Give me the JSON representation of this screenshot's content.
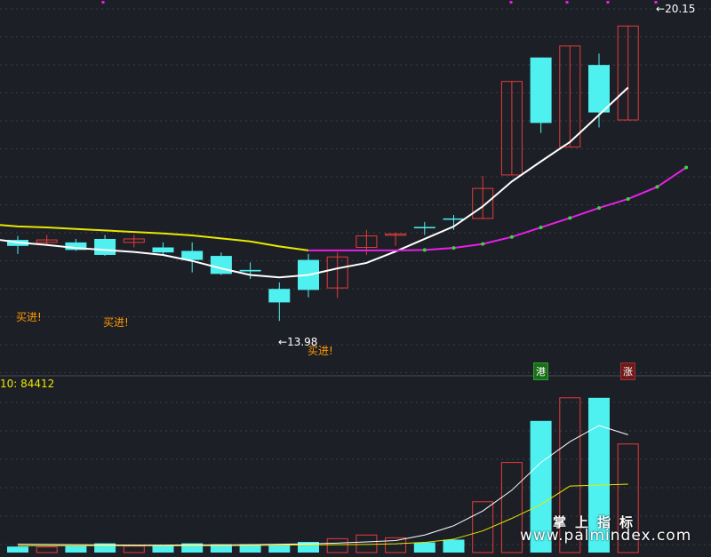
{
  "chart_data": {
    "type": "candlestick",
    "price_axis": {
      "min": 12.9,
      "max": 20.4
    },
    "candles": [
      {
        "open": 15.6,
        "close": 15.48,
        "high": 15.68,
        "low": 15.32
      },
      {
        "open": 15.55,
        "close": 15.6,
        "high": 15.7,
        "low": 15.5
      },
      {
        "open": 15.55,
        "close": 15.4,
        "high": 15.62,
        "low": 15.38
      },
      {
        "open": 15.62,
        "close": 15.3,
        "high": 15.7,
        "low": 15.28
      },
      {
        "open": 15.55,
        "close": 15.62,
        "high": 15.7,
        "low": 15.45
      },
      {
        "open": 15.45,
        "close": 15.35,
        "high": 15.55,
        "low": 15.3
      },
      {
        "open": 15.38,
        "close": 15.2,
        "high": 15.55,
        "low": 14.95
      },
      {
        "open": 15.28,
        "close": 14.92,
        "high": 15.35,
        "low": 14.9
      },
      {
        "open": 15.0,
        "close": 14.97,
        "high": 15.15,
        "low": 14.82
      },
      {
        "open": 14.62,
        "close": 14.35,
        "high": 14.75,
        "low": 13.98
      },
      {
        "open": 15.2,
        "close": 14.6,
        "high": 15.32,
        "low": 14.45
      },
      {
        "open": 14.64,
        "close": 15.26,
        "high": 15.35,
        "low": 14.44
      },
      {
        "open": 15.45,
        "close": 15.68,
        "high": 15.8,
        "low": 15.3
      },
      {
        "open": 15.7,
        "close": 15.72,
        "high": 15.75,
        "low": 15.48
      },
      {
        "open": 15.86,
        "close": 15.84,
        "high": 15.96,
        "low": 15.7
      },
      {
        "open": 16.03,
        "close": 16.01,
        "high": 16.1,
        "low": 15.8
      },
      {
        "open": 16.03,
        "close": 16.63,
        "high": 16.88,
        "low": 16.03
      },
      {
        "open": 16.9,
        "close": 18.77,
        "high": 18.77,
        "low": 16.9
      },
      {
        "open": 19.25,
        "close": 17.94,
        "high": 19.25,
        "low": 17.74
      },
      {
        "open": 17.46,
        "close": 19.48,
        "high": 19.48,
        "low": 17.46
      },
      {
        "open": 19.1,
        "close": 18.15,
        "high": 19.33,
        "low": 17.85
      },
      {
        "open": 18.0,
        "close": 19.88,
        "high": 19.88,
        "low": 18.0
      }
    ],
    "ma_white": [
      15.6,
      15.55,
      15.5,
      15.44,
      15.4,
      15.36,
      15.3,
      15.18,
      15.03,
      14.9,
      14.85,
      14.9,
      15.03,
      15.14,
      15.37,
      15.62,
      15.87,
      16.27,
      16.77,
      17.17,
      17.56,
      18.1,
      18.65
    ],
    "ma_yellow": [
      15.9,
      15.87,
      15.85,
      15.82,
      15.79,
      15.76,
      15.73,
      15.69,
      15.63,
      15.57,
      15.47,
      15.39
    ],
    "ma_magenta": [
      15.39,
      15.39,
      15.39,
      15.39,
      15.4,
      15.44,
      15.52,
      15.66,
      15.85,
      16.04,
      16.24,
      16.42,
      16.66,
      17.05
    ],
    "volume": [
      130,
      120,
      140,
      200,
      140,
      160,
      200,
      180,
      180,
      160,
      230,
      300,
      380,
      320,
      220,
      280,
      1100,
      1950,
      2850,
      3350,
      3350,
      2350
    ],
    "volume_axis": {
      "min": 0,
      "max": 3500
    },
    "vol_ma_white": [
      180,
      175,
      170,
      165,
      160,
      160,
      165,
      165,
      170,
      180,
      190,
      205,
      230,
      260,
      380,
      580,
      900,
      1350,
      1950,
      2400,
      2750,
      2550
    ],
    "vol_ma_yellow": [
      150,
      150,
      150,
      150,
      150,
      150,
      150,
      150,
      155,
      160,
      165,
      170,
      175,
      190,
      220,
      290,
      470,
      740,
      1040,
      1440,
      1460,
      1480
    ]
  },
  "labels": {
    "top_price": "20.15",
    "low_price": "13.98",
    "buy": "买进!",
    "vol_header": "10: 84412",
    "badge_gang": "港",
    "badge_zhang": "涨",
    "watermark_cn": "掌上指标",
    "watermark_url": "www.palmindex.com"
  },
  "colors": {
    "bg": "#1d1f26",
    "up": "#e63b3b",
    "down": "#4ef0f0",
    "ma_white": "#ffffff",
    "ma_yellow": "#e8e800",
    "ma_magenta": "#e620e6",
    "dot": "#3bd63b",
    "grid": "#3a3d48"
  }
}
